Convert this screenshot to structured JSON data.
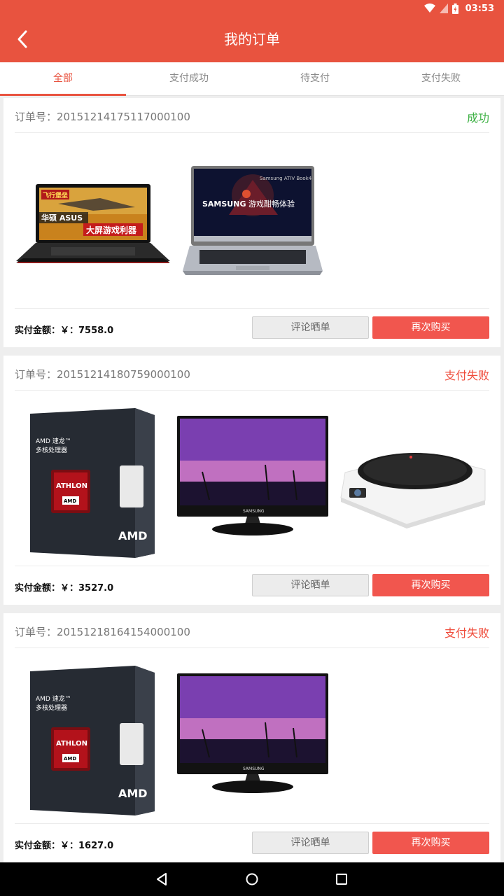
{
  "status_bar": {
    "time": "03:53"
  },
  "app_bar": {
    "title": "我的订单"
  },
  "tabs": [
    {
      "label": "全部",
      "active": true
    },
    {
      "label": "支付成功",
      "active": false
    },
    {
      "label": "待支付",
      "active": false
    },
    {
      "label": "支付失败",
      "active": false
    }
  ],
  "colors": {
    "accent": "#e8533f",
    "success": "#3cb043",
    "fail": "#ef4b3a",
    "rebuy": "#f1564e"
  },
  "orders": [
    {
      "number_label": "订单号：20151214175117000100",
      "status": "成功",
      "amount_label": "实付金额：￥：7558.0",
      "review_label": "评论晒单",
      "rebuy_label": "再次购买",
      "products": [
        {
          "icon": "asus-laptop-image",
          "banner": "华硕 ASUS 大屏游戏利器"
        },
        {
          "icon": "samsung-laptop-image",
          "brand": "SAMSUNG",
          "tagline": "游戏酣畅体验",
          "model": "Samsung ATIV Book4"
        }
      ]
    },
    {
      "number_label": "订单号：20151214180759000100",
      "status": "支付失败",
      "amount_label": "实付金额：￥：3527.0",
      "review_label": "评论晒单",
      "rebuy_label": "再次购买",
      "products": [
        {
          "icon": "amd-cpu-box-image",
          "brand": "AMD",
          "line1": "AMD 速龙™",
          "line2": "多核处理器",
          "badge": "ATHLON"
        },
        {
          "icon": "samsung-monitor-image",
          "brand": "SAMSUNG"
        },
        {
          "icon": "projector-image"
        }
      ]
    },
    {
      "number_label": "订单号：20151218164154000100",
      "status": "支付失败",
      "amount_label": "实付金额：￥：1627.0",
      "review_label": "评论晒单",
      "rebuy_label": "再次购买",
      "products": [
        {
          "icon": "amd-cpu-box-image",
          "brand": "AMD",
          "line1": "AMD 速龙™",
          "line2": "多核处理器",
          "badge": "ATHLON"
        },
        {
          "icon": "samsung-monitor-image",
          "brand": "SAMSUNG"
        }
      ]
    }
  ]
}
